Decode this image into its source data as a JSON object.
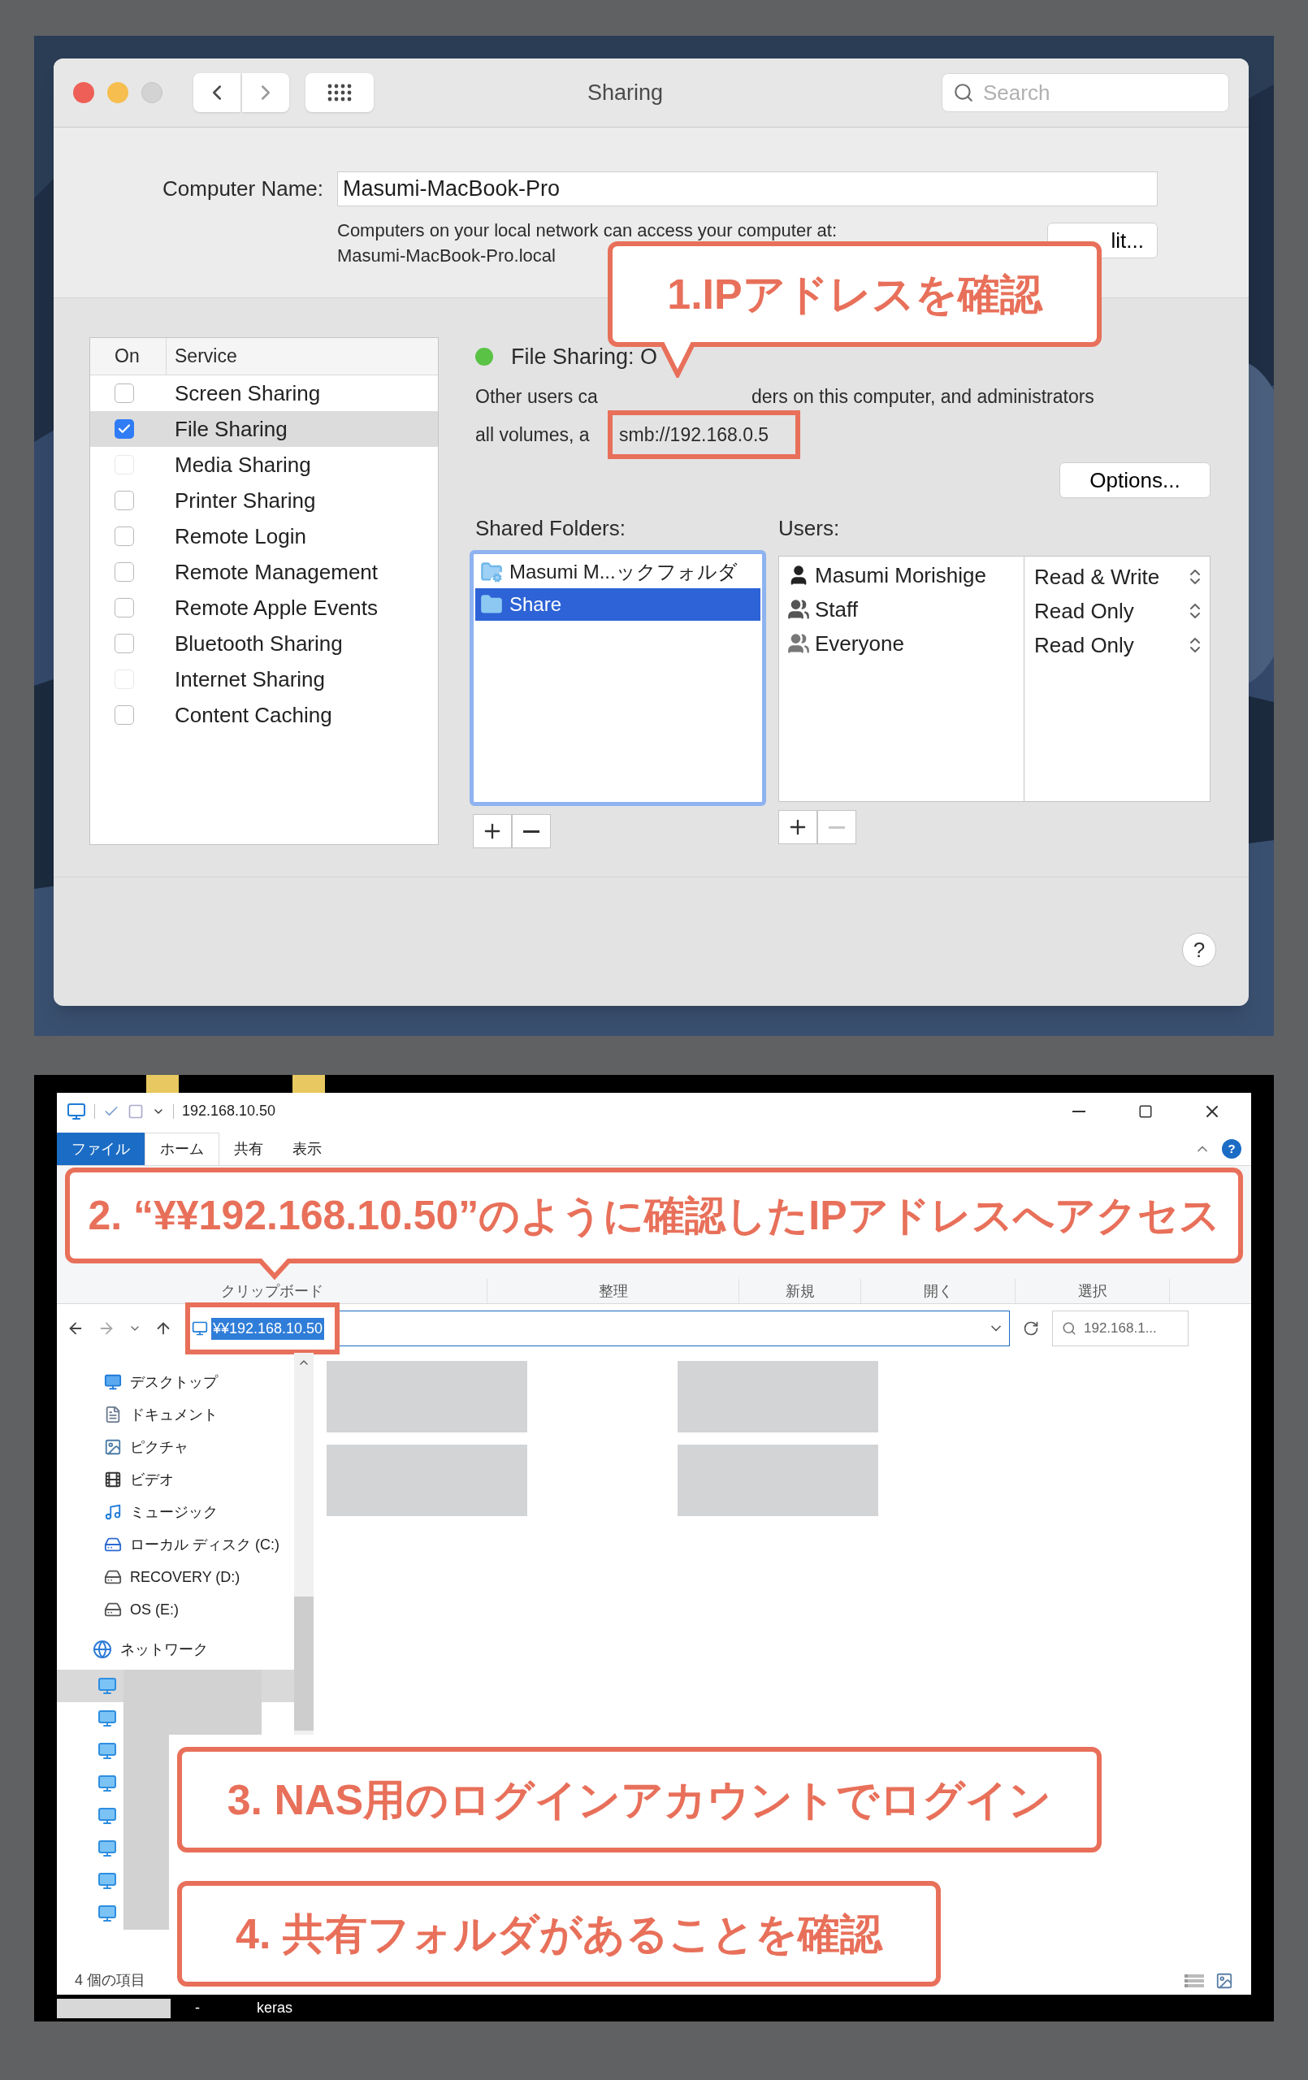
{
  "mac_window": {
    "title": "Sharing",
    "search": {
      "placeholder": "Search"
    },
    "computer_name": {
      "label": "Computer Name:",
      "value": "Masumi-MacBook-Pro"
    },
    "address_note": [
      "Computers on your local network can access your computer at:",
      "Masumi-MacBook-Pro.local"
    ],
    "edit_button": "lit...",
    "services": {
      "columns": [
        "On",
        "Service"
      ],
      "items": [
        {
          "name": "Screen Sharing",
          "checked": false,
          "disabled": false,
          "selected": false
        },
        {
          "name": "File Sharing",
          "checked": true,
          "disabled": false,
          "selected": true
        },
        {
          "name": "Media Sharing",
          "checked": false,
          "disabled": true,
          "selected": false
        },
        {
          "name": "Printer Sharing",
          "checked": false,
          "disabled": false,
          "selected": false
        },
        {
          "name": "Remote Login",
          "checked": false,
          "disabled": false,
          "selected": false
        },
        {
          "name": "Remote Management",
          "checked": false,
          "disabled": false,
          "selected": false
        },
        {
          "name": "Remote Apple Events",
          "checked": false,
          "disabled": false,
          "selected": false
        },
        {
          "name": "Bluetooth Sharing",
          "checked": false,
          "disabled": false,
          "selected": false
        },
        {
          "name": "Internet Sharing",
          "checked": false,
          "disabled": true,
          "selected": false
        },
        {
          "name": "Content Caching",
          "checked": false,
          "disabled": false,
          "selected": false
        }
      ]
    },
    "status": {
      "text": "File Sharing: O",
      "on": true
    },
    "description": [
      "Other users ca",
      "ders on this computer, and administrators",
      "all volumes, a"
    ],
    "smb_address": "smb://192.168.0.5",
    "options_button": "Options...",
    "shared_folders": {
      "label": "Shared Folders:",
      "remove_disabled": false,
      "items": [
        {
          "name": "Masumi M...ックフォルダ",
          "kind": "smart",
          "selected": false
        },
        {
          "name": "Share",
          "kind": "folder",
          "selected": true
        }
      ]
    },
    "users": {
      "label": "Users:",
      "remove_disabled": true,
      "items": [
        {
          "name": "Masumi Morishige",
          "kind": "person",
          "permission": "Read & Write"
        },
        {
          "name": "Staff",
          "kind": "group",
          "permission": "Read Only"
        },
        {
          "name": "Everyone",
          "kind": "everyone",
          "permission": "Read Only"
        }
      ]
    },
    "help_button": "?"
  },
  "explorer": {
    "title": "192.168.10.50",
    "ribbon_tabs": [
      {
        "label": "ファイル",
        "kind": "file",
        "selected": false
      },
      {
        "label": "ホーム",
        "kind": "tab",
        "selected": true
      },
      {
        "label": "共有",
        "kind": "tab",
        "selected": false
      },
      {
        "label": "表示",
        "kind": "tab",
        "selected": false
      }
    ],
    "ribbon_groups": [
      "クリップボード",
      "整理",
      "新規",
      "開く",
      "選択"
    ],
    "address": "¥¥192.168.10.50",
    "search": {
      "placeholder": "192.168.1..."
    },
    "nav_items": [
      {
        "label": "デスクトップ",
        "kind": "desktop"
      },
      {
        "label": "ドキュメント",
        "kind": "document"
      },
      {
        "label": "ピクチャ",
        "kind": "picture"
      },
      {
        "label": "ビデオ",
        "kind": "video"
      },
      {
        "label": "ミュージック",
        "kind": "music"
      },
      {
        "label": "ローカル ディスク (C:)",
        "kind": "system-drive"
      },
      {
        "label": "RECOVERY (D:)",
        "kind": "drive"
      },
      {
        "label": "OS (E:)",
        "kind": "drive"
      }
    ],
    "network": {
      "label": "ネットワーク",
      "computers": [
        {
          "selected": true
        },
        {
          "selected": false
        },
        {
          "selected": false
        },
        {
          "selected": false
        },
        {
          "selected": false
        },
        {
          "selected": false
        },
        {
          "selected": false
        },
        {
          "selected": false
        }
      ]
    },
    "help_button": "?",
    "status": "4 個の項目"
  },
  "taskbar": [
    "-",
    "keras"
  ],
  "callouts": [
    "1.IPアドレスを確認",
    "2. “¥¥192.168.10.50”のように確認したIPアドレスへアクセス",
    "3. NAS用のログインアカウントでログイン",
    "4. 共有フォルダがあることを確認"
  ]
}
